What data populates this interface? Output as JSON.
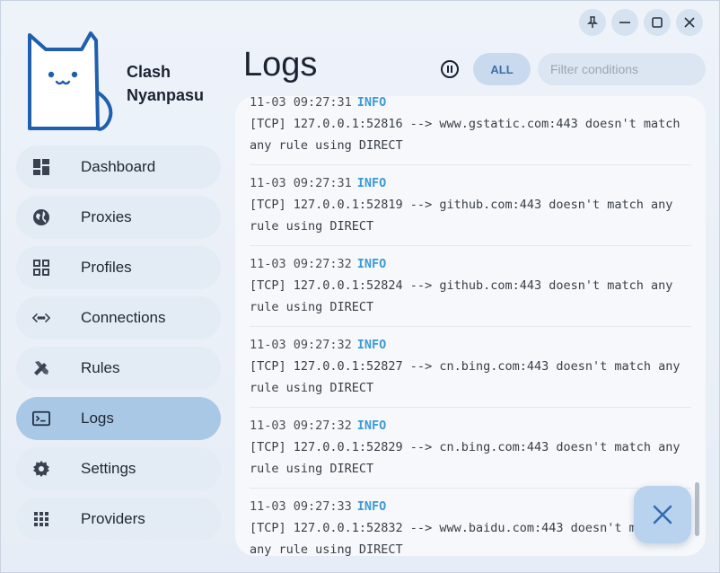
{
  "app": {
    "name_line1": "Clash",
    "name_line2": "Nyanpasu"
  },
  "window_controls": [
    "pin-icon",
    "minimize-icon",
    "maximize-icon",
    "close-icon"
  ],
  "sidebar": {
    "items": [
      {
        "label": "Dashboard",
        "icon": "dashboard-icon",
        "active": false
      },
      {
        "label": "Proxies",
        "icon": "globe-icon",
        "active": false
      },
      {
        "label": "Profiles",
        "icon": "grid-icon",
        "active": false
      },
      {
        "label": "Connections",
        "icon": "code-arrows-icon",
        "active": false
      },
      {
        "label": "Rules",
        "icon": "tools-icon",
        "active": false
      },
      {
        "label": "Logs",
        "icon": "terminal-icon",
        "active": true
      },
      {
        "label": "Settings",
        "icon": "gear-icon",
        "active": false
      },
      {
        "label": "Providers",
        "icon": "dots-grid-icon",
        "active": false
      }
    ]
  },
  "header": {
    "title": "Logs",
    "level_label": "ALL",
    "filter_placeholder": "Filter conditions"
  },
  "logs": [
    {
      "time": "11-03 09:27:31",
      "level": "INFO",
      "message": "[TCP] 127.0.0.1:52816 --> www.gstatic.com:443 doesn't match any rule using DIRECT"
    },
    {
      "time": "11-03 09:27:31",
      "level": "INFO",
      "message": "[TCP] 127.0.0.1:52819 --> github.com:443 doesn't match any rule using DIRECT"
    },
    {
      "time": "11-03 09:27:32",
      "level": "INFO",
      "message": "[TCP] 127.0.0.1:52824 --> github.com:443 doesn't match any rule using DIRECT"
    },
    {
      "time": "11-03 09:27:32",
      "level": "INFO",
      "message": "[TCP] 127.0.0.1:52827 --> cn.bing.com:443 doesn't match any rule using DIRECT"
    },
    {
      "time": "11-03 09:27:32",
      "level": "INFO",
      "message": "[TCP] 127.0.0.1:52829 --> cn.bing.com:443 doesn't match any rule using DIRECT"
    },
    {
      "time": "11-03 09:27:33",
      "level": "INFO",
      "message": "[TCP] 127.0.0.1:52832 --> www.baidu.com:443 doesn't match any rule using DIRECT"
    }
  ],
  "colors": {
    "accent": "#a9c8e6",
    "info": "#3b9ad6",
    "cat_outline": "#1f5fae"
  }
}
